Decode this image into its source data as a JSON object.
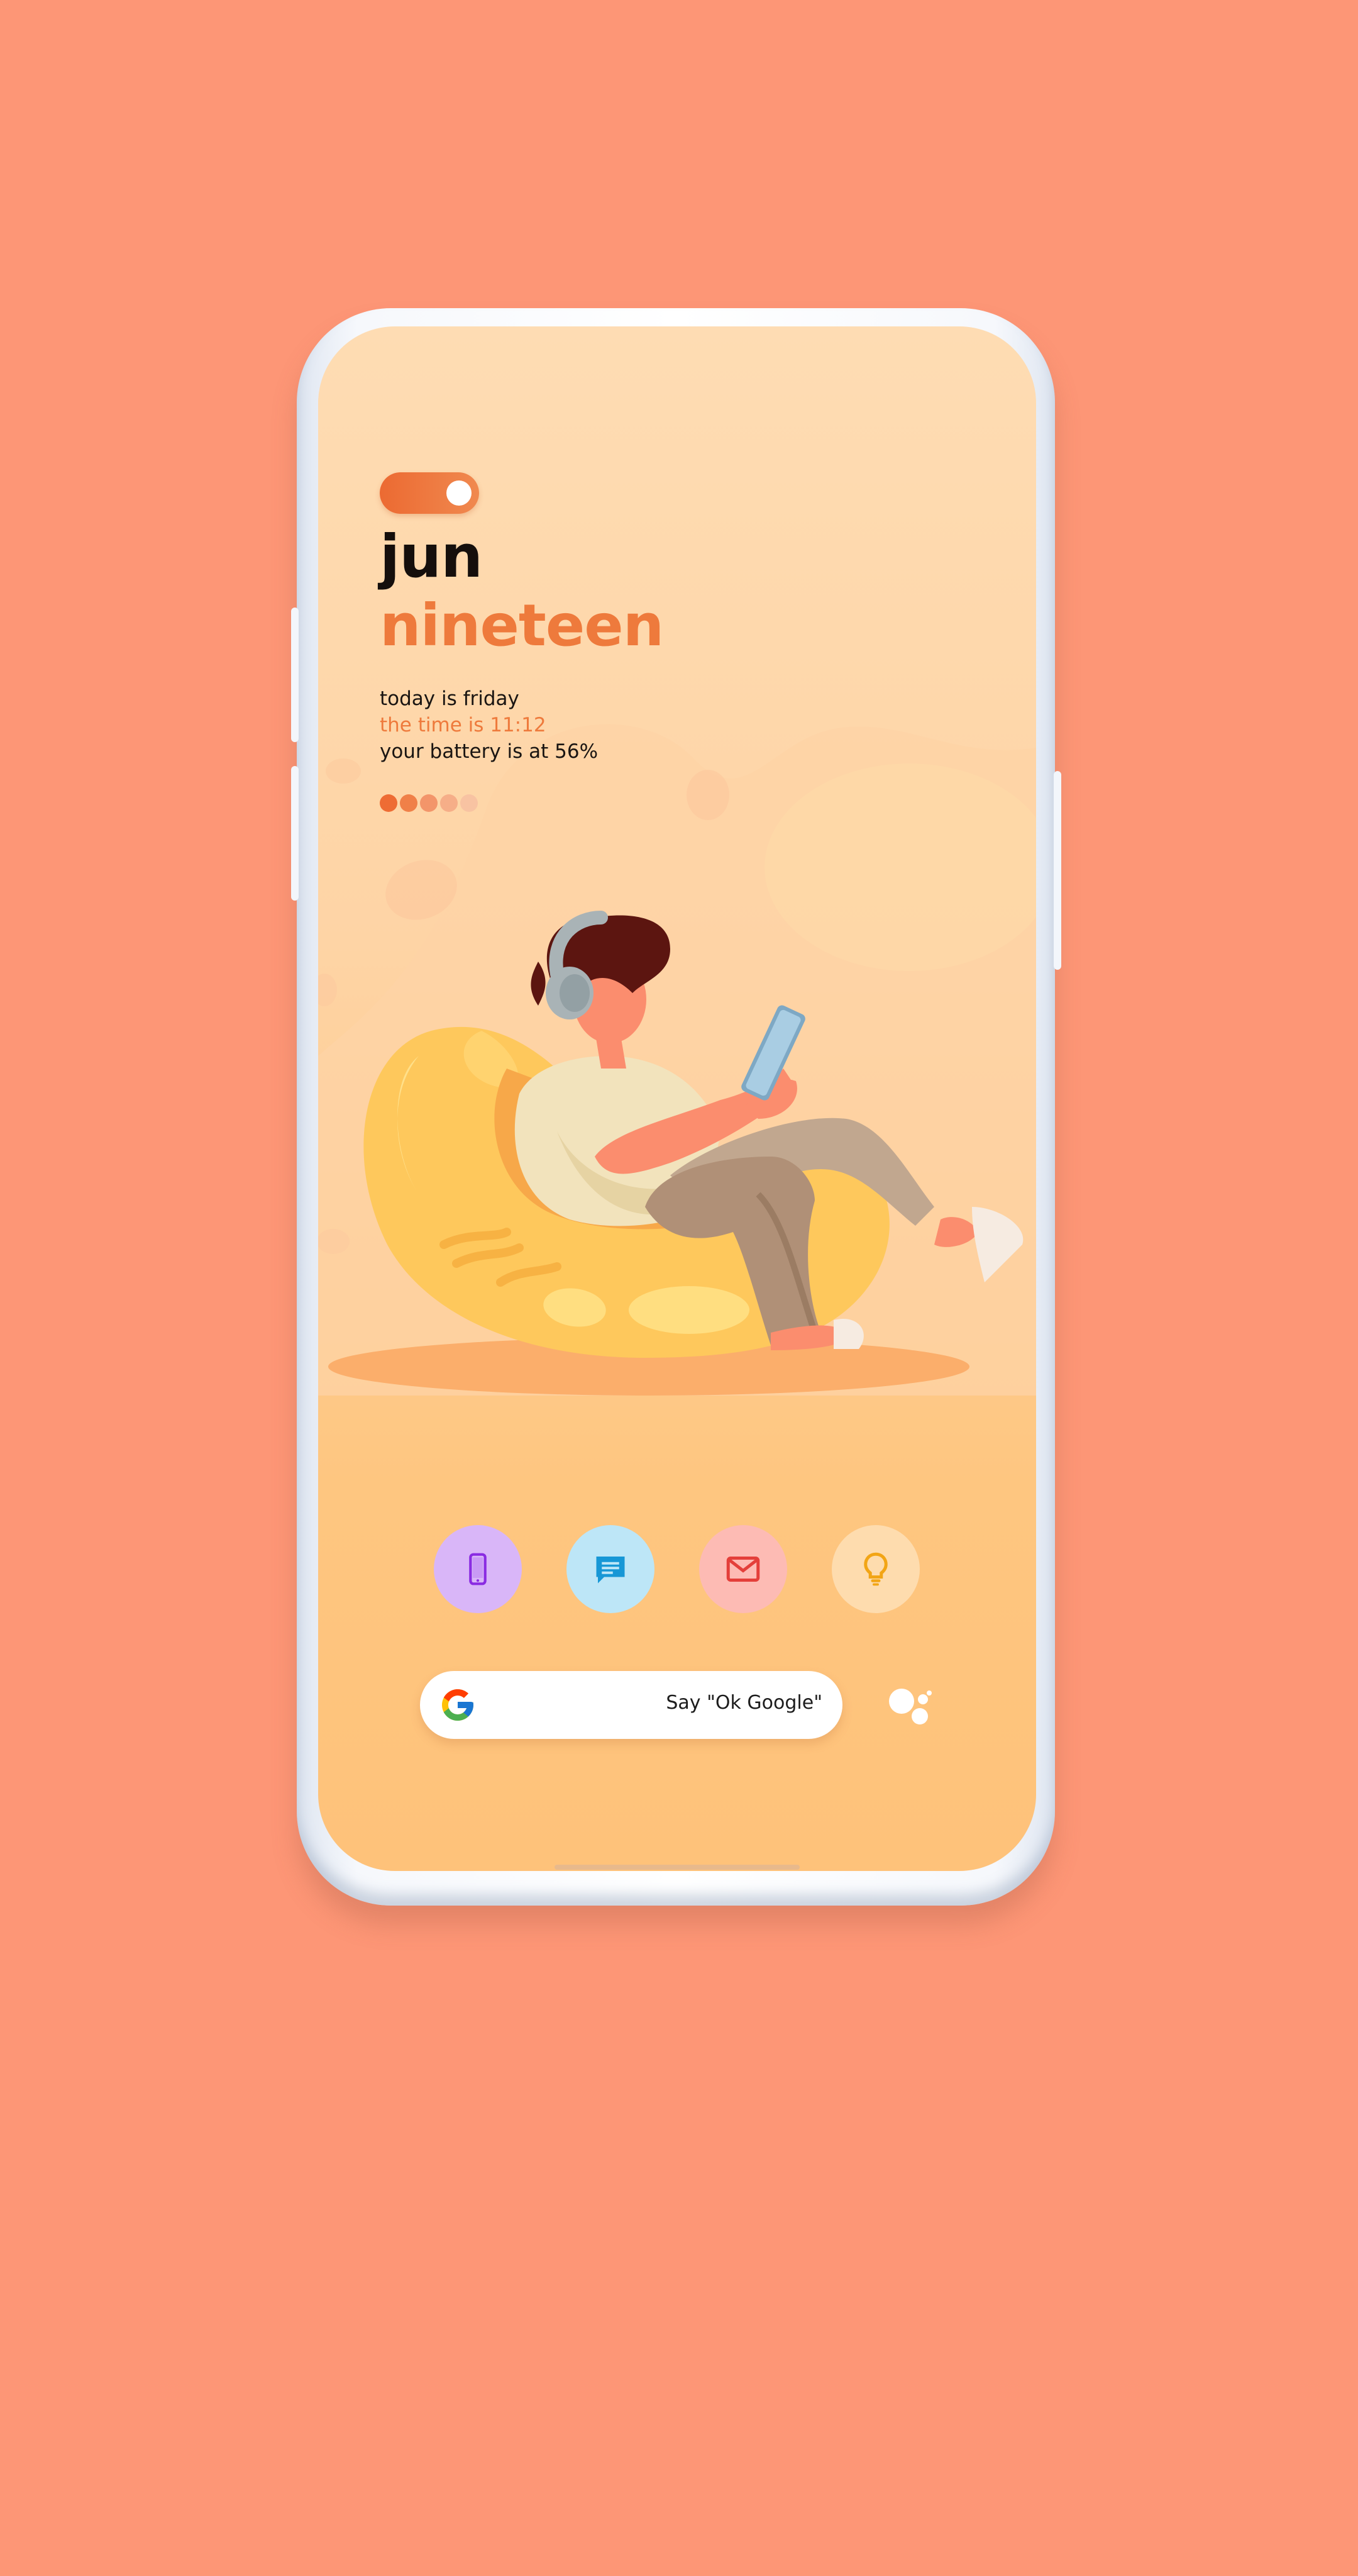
{
  "toggle": {
    "state": "on"
  },
  "date": {
    "month": "jun",
    "day": "nineteen"
  },
  "info": {
    "day_line": "today is friday",
    "time_line": "the time is 11:12",
    "battery_line": "your battery is at 56%"
  },
  "page_dots": {
    "count": 5,
    "active_index": 0
  },
  "dock": [
    {
      "icon": "phone-icon",
      "bg": "#d9b6f8",
      "fg": "#8a2be2"
    },
    {
      "icon": "message-icon",
      "bg": "#bde6f7",
      "fg": "#1797d6"
    },
    {
      "icon": "mail-icon",
      "bg": "#fdbbb4",
      "fg": "#e43f3a"
    },
    {
      "icon": "lightbulb-icon",
      "bg": "#fedcae",
      "fg": "#f2a516"
    }
  ],
  "search": {
    "hint": "Say \"Ok Google\"",
    "logo": "google-g-icon"
  },
  "assistant": {
    "icon": "assistant-icon"
  },
  "colors": {
    "background": "#fd9676",
    "accent": "#ee7a3c",
    "text": "#150f0c"
  }
}
